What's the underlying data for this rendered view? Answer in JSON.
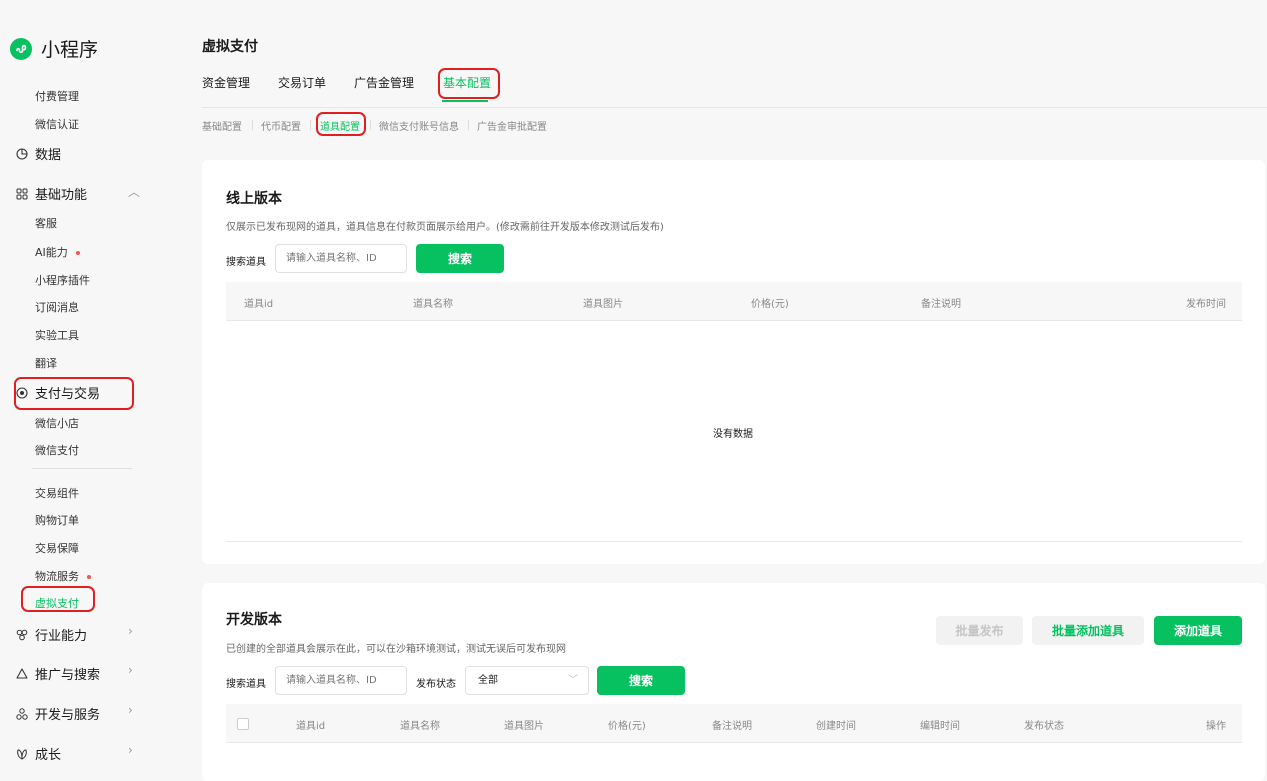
{
  "app": {
    "name": "小程序"
  },
  "sidebar": {
    "items": [
      {
        "label": "付费管理"
      },
      {
        "label": "微信认证"
      },
      {
        "label": "数据"
      },
      {
        "label": "基础功能"
      },
      {
        "label": "客服"
      },
      {
        "label": "AI能力"
      },
      {
        "label": "小程序插件"
      },
      {
        "label": "订阅消息"
      },
      {
        "label": "实验工具"
      },
      {
        "label": "翻译"
      },
      {
        "label": "支付与交易"
      },
      {
        "label": "微信小店"
      },
      {
        "label": "微信支付"
      },
      {
        "label": "交易组件"
      },
      {
        "label": "购物订单"
      },
      {
        "label": "交易保障"
      },
      {
        "label": "物流服务"
      },
      {
        "label": "虚拟支付"
      },
      {
        "label": "行业能力"
      },
      {
        "label": "推广与搜索"
      },
      {
        "label": "开发与服务"
      },
      {
        "label": "成长"
      }
    ]
  },
  "header": {
    "title": "虚拟支付",
    "tabs": [
      {
        "label": "资金管理"
      },
      {
        "label": "交易订单"
      },
      {
        "label": "广告金管理"
      },
      {
        "label": "基本配置"
      }
    ],
    "subtabs": [
      {
        "label": "基础配置"
      },
      {
        "label": "代币配置"
      },
      {
        "label": "道具配置"
      },
      {
        "label": "微信支付账号信息"
      },
      {
        "label": "广告金审批配置"
      }
    ]
  },
  "online": {
    "title": "线上版本",
    "desc": "仅展示已发布现网的道具，道具信息在付款页面展示给用户。(修改需前往开发版本修改测试后发布)",
    "search_label": "搜索道具",
    "search_placeholder": "请输入道具名称、ID",
    "search_button": "搜索",
    "columns": [
      "道具id",
      "道具名称",
      "道具图片",
      "价格(元)",
      "备注说明",
      "发布时间"
    ],
    "empty_text": "没有数据"
  },
  "dev": {
    "title": "开发版本",
    "desc": "已创建的全部道具会展示在此，可以在沙箱环境测试，测试无误后可发布现网",
    "batch_publish": "批量发布",
    "batch_add": "批量添加道具",
    "add": "添加道具",
    "search_label": "搜索道具",
    "search_placeholder": "请输入道具名称、ID",
    "status_label": "发布状态",
    "status_value": "全部",
    "search_button": "搜索",
    "columns": [
      "道具id",
      "道具名称",
      "道具图片",
      "价格(元)",
      "备注说明",
      "创建时间",
      "编辑时间",
      "发布状态",
      "操作"
    ]
  },
  "colors": {
    "brand": "#07c160",
    "highlight": "#e02020",
    "dot": "#fa5151"
  }
}
